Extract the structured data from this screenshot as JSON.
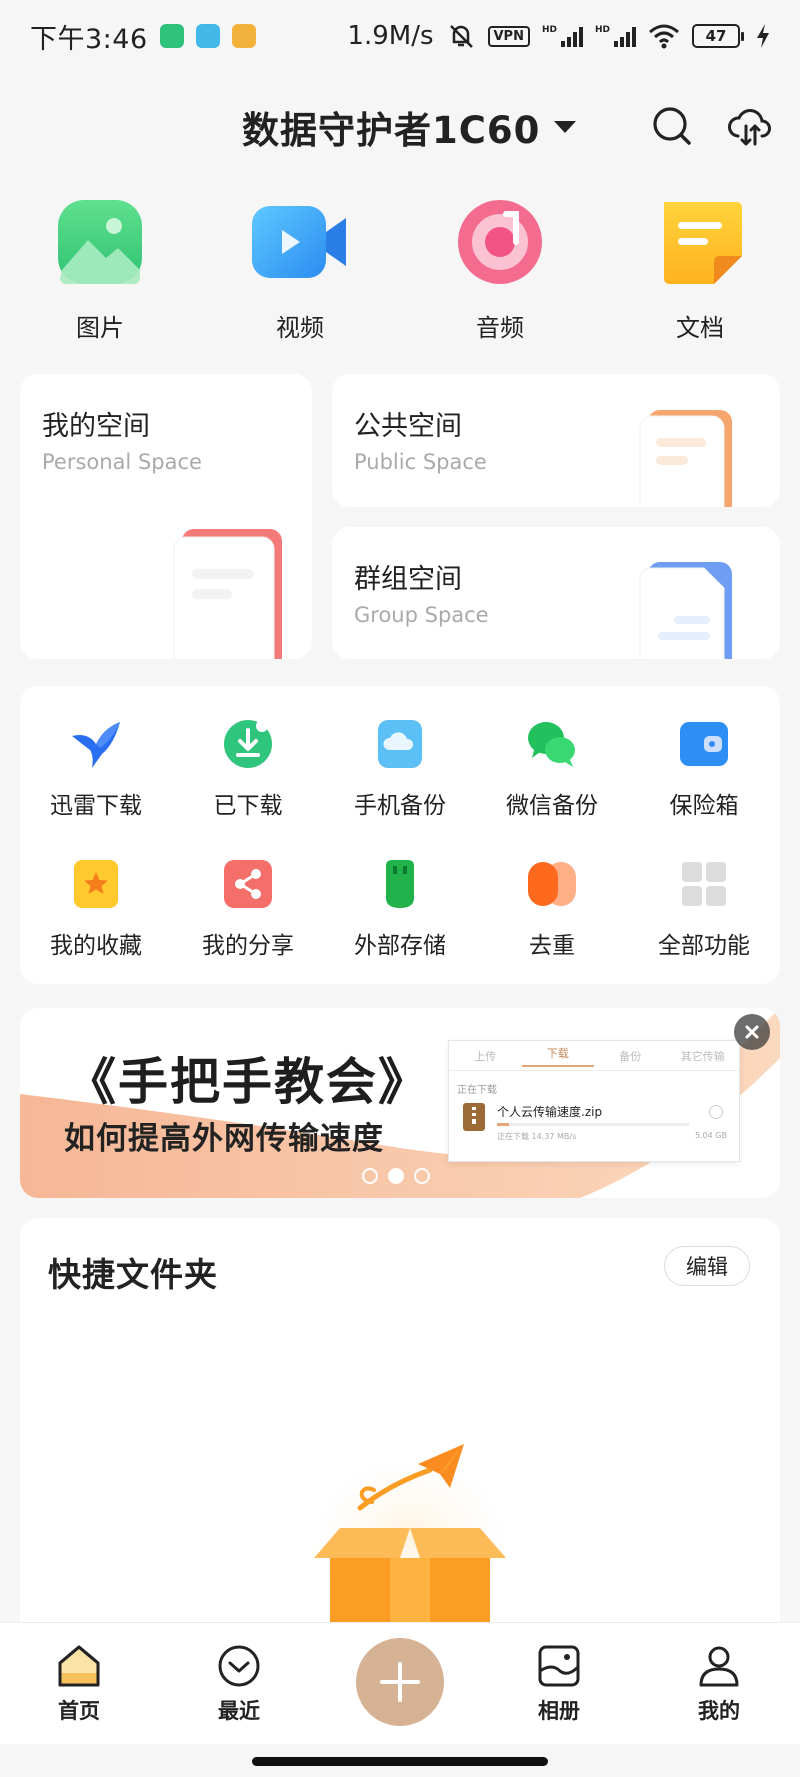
{
  "status_bar": {
    "time": "下午3:46",
    "speed": "1.9M/s",
    "vpn": "VPN",
    "hd1": "HD",
    "hd2": "HD",
    "battery": "47"
  },
  "header": {
    "title": "数据守护者1C60"
  },
  "categories": [
    {
      "label": "图片",
      "icon": "picture-icon"
    },
    {
      "label": "视频",
      "icon": "video-icon"
    },
    {
      "label": "音频",
      "icon": "audio-icon"
    },
    {
      "label": "文档",
      "icon": "document-icon"
    }
  ],
  "spaces": {
    "personal": {
      "title": "我的空间",
      "subtitle": "Personal Space"
    },
    "public": {
      "title": "公共空间",
      "subtitle": "Public Space"
    },
    "group": {
      "title": "群组空间",
      "subtitle": "Group Space"
    }
  },
  "tools": [
    {
      "label": "迅雷下载",
      "icon": "thunder-bird-icon"
    },
    {
      "label": "已下载",
      "icon": "downloaded-icon"
    },
    {
      "label": "手机备份",
      "icon": "phone-backup-icon"
    },
    {
      "label": "微信备份",
      "icon": "wechat-backup-icon"
    },
    {
      "label": "保险箱",
      "icon": "safe-box-icon"
    },
    {
      "label": "我的收藏",
      "icon": "favorites-icon"
    },
    {
      "label": "我的分享",
      "icon": "share-icon"
    },
    {
      "label": "外部存储",
      "icon": "external-storage-icon"
    },
    {
      "label": "去重",
      "icon": "dedupe-icon"
    },
    {
      "label": "全部功能",
      "icon": "all-functions-icon"
    }
  ],
  "banner": {
    "headline": "《手把手教会》",
    "subheadline": "如何提高外网传输速度",
    "tabs": [
      "上传",
      "下载",
      "备份",
      "其它传输"
    ],
    "section": "正在下载",
    "file_name": "个人云传输速度.zip",
    "file_status": "正在下载  14.37 MB/s",
    "file_size": "5.04 GB",
    "slides_total": 3,
    "slide_active": 2
  },
  "quick_folder": {
    "title": "快捷文件夹",
    "edit_label": "编辑"
  },
  "bottom_nav": [
    {
      "label": "首页",
      "icon": "home-icon"
    },
    {
      "label": "最近",
      "icon": "recent-icon"
    },
    {
      "label": "相册",
      "icon": "album-icon"
    },
    {
      "label": "我的",
      "icon": "profile-icon"
    }
  ],
  "colors": {
    "accent": "#d5b293",
    "background": "#f6f6f6",
    "card": "#ffffff"
  }
}
